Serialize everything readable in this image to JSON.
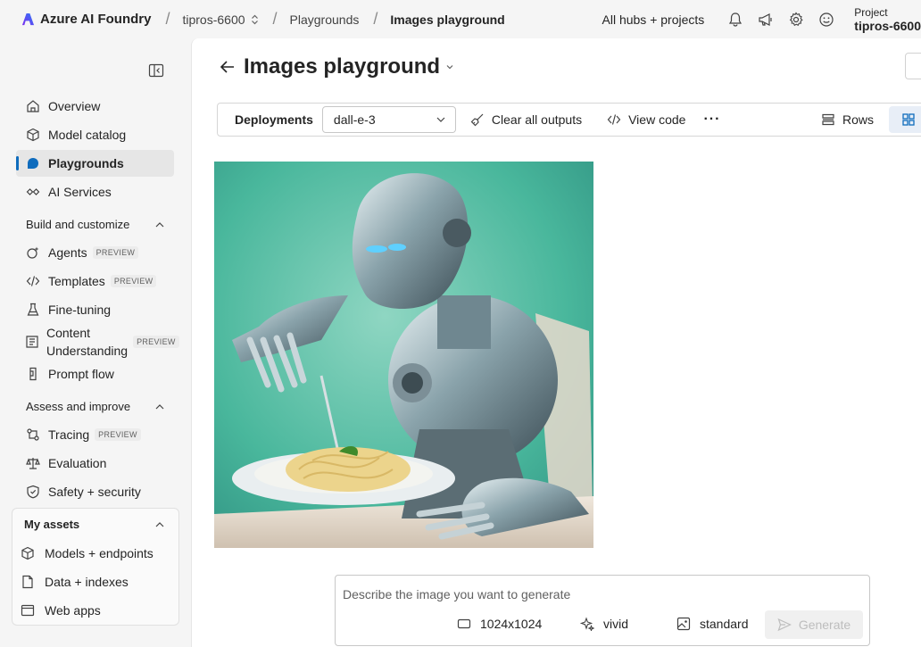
{
  "topbar": {
    "brand": "Azure AI Foundry",
    "hub": "tipros-6600",
    "crumb_playgrounds": "Playgrounds",
    "crumb_current": "Images playground",
    "all_hubs": "All hubs + projects",
    "project_label": "Project",
    "project_name": "tipros-6600"
  },
  "sidebar": {
    "items": [
      {
        "label": "Overview",
        "icon": "home-icon"
      },
      {
        "label": "Model catalog",
        "icon": "cube-icon"
      },
      {
        "label": "Playgrounds",
        "icon": "chat-icon",
        "active": true
      },
      {
        "label": "AI Services",
        "icon": "link-icon"
      }
    ],
    "section_build": "Build and customize",
    "build_items": [
      {
        "label": "Agents",
        "badge": "PREVIEW"
      },
      {
        "label": "Templates",
        "badge": "PREVIEW"
      },
      {
        "label": "Fine-tuning"
      },
      {
        "label": "Content Understanding",
        "badge": "PREVIEW"
      },
      {
        "label": "Prompt flow"
      }
    ],
    "section_assess": "Assess and improve",
    "assess_items": [
      {
        "label": "Tracing",
        "badge": "PREVIEW"
      },
      {
        "label": "Evaluation"
      },
      {
        "label": "Safety + security"
      }
    ],
    "assets_head": "My assets",
    "asset_items": [
      {
        "label": "Models + endpoints"
      },
      {
        "label": "Data + indexes"
      },
      {
        "label": "Web apps"
      }
    ]
  },
  "main": {
    "title": "Images playground",
    "toolbar": {
      "deployments_label": "Deployments",
      "deployment_value": "dall-e-3",
      "clear": "Clear all outputs",
      "view_code": "View code",
      "more": "···",
      "rows": "Rows"
    },
    "prompt": {
      "placeholder": "Describe the image you want to generate",
      "size": "1024x1024",
      "style": "vivid",
      "quality": "standard",
      "generate": "Generate"
    }
  },
  "colors": {
    "accent": "#0f6cbd",
    "image_bg": "#3fae94"
  }
}
